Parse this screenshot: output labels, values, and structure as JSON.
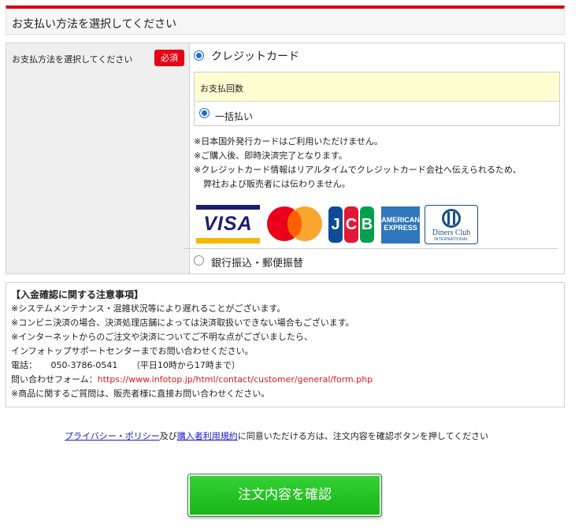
{
  "section": {
    "title": "お支払い方法を選択してください"
  },
  "payment_form": {
    "label": "お支払方法を選択してください",
    "required_badge": "必須",
    "credit_card_option": "クレジットカード",
    "installments": {
      "header": "お支払回数",
      "once_option": "一括払い"
    },
    "notes": [
      "※日本国外発行カードはご利用いただけません。",
      "※ご購入後、即時決済完了となります。",
      "※クレジットカード情報はリアルタイムでクレジットカード会社へ伝えられるため、",
      "弊社および販売者には伝わりません。"
    ],
    "card_brands": {
      "visa": "VISA",
      "jcb": [
        "J",
        "C",
        "B"
      ],
      "amex": [
        "AMERICAN",
        "EXPRESS"
      ],
      "diners": "Diners Club",
      "diners_sub": "INTERNATIONAL"
    },
    "bank_option": "銀行振込・郵便振替"
  },
  "notice": {
    "heading": "【入金確認に関する注意事項】",
    "lines": [
      "※システムメンテナンス・混雑状況等により遅れることがございます。",
      "※コンビニ決済の場合、決済処理店舗によっては決済取扱いできない場合もございます。",
      "※インターネットからのご注文や決済についてご不明な点がございましたら、",
      "インフォトップサポートセンターまでお問い合わせください。"
    ],
    "phone_label": "電話：",
    "phone_number": "050-3786-0541",
    "phone_hours": "（平日10時から17時まで）",
    "form_label": "問い合わせフォーム：",
    "form_url": "https://www.infotop.jp/html/contact/customer/general/form.php",
    "product_note": "※商品に関するご質問は、販売者様に直接お問い合わせください。"
  },
  "agreement": {
    "privacy_link": "プライバシー・ポリシー",
    "conjunction": "及び",
    "terms_link": "購入者利用規約",
    "text": "に同意いただける方は、注文内容を確認ボタンを押してください"
  },
  "confirm_button": "注文内容を確認",
  "colors": {
    "accent_red": "#d50000",
    "badge_red": "#e60012",
    "radio_blue": "#1c6fd8",
    "button_green": "#17b417",
    "highlight_yellow": "#fffdd2",
    "link_blue": "#1a1acc",
    "url_red": "#d81b1b"
  }
}
